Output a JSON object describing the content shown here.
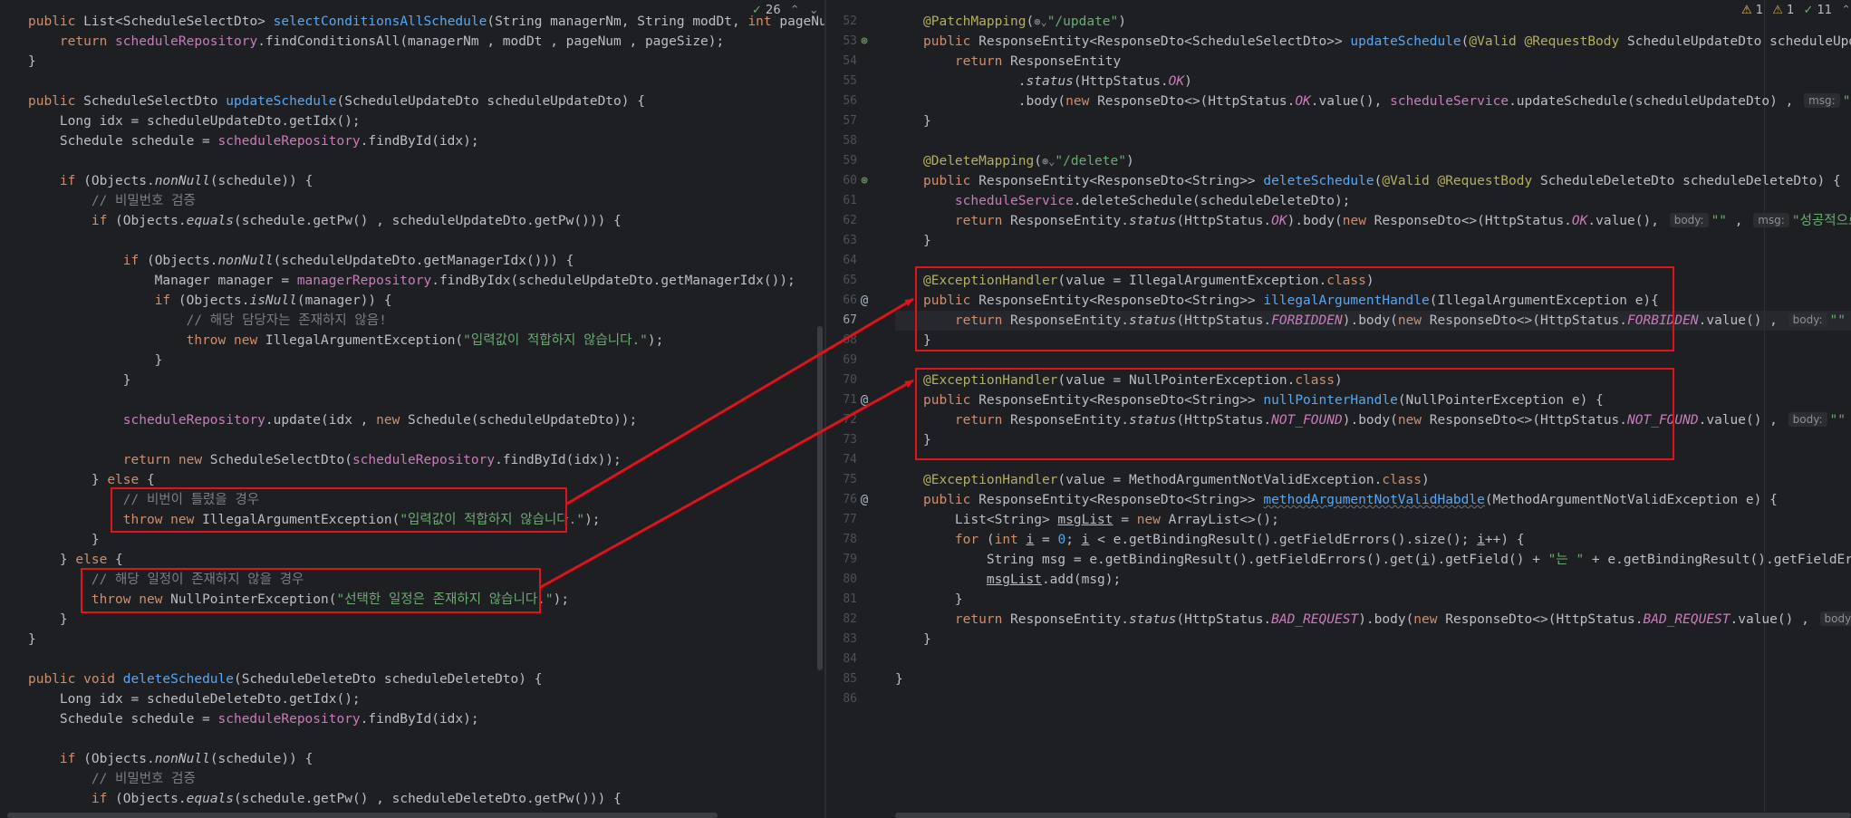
{
  "left_pane": {
    "inspection": {
      "check_count": "26",
      "up": "⌃",
      "down": "⌄"
    }
  },
  "right_pane": {
    "inspection": {
      "warning_count": "1",
      "weak_warning_count": "1",
      "check_count": "11",
      "up": "⌃",
      "down": "⌄"
    },
    "line_numbers": [
      "52",
      "53",
      "54",
      "55",
      "56",
      "57",
      "58",
      "59",
      "60",
      "61",
      "62",
      "63",
      "64",
      "65",
      "66",
      "67",
      "68",
      "69",
      "70",
      "71",
      "72",
      "73",
      "74",
      "75",
      "76",
      "77",
      "78",
      "79",
      "80",
      "81",
      "82",
      "83",
      "84",
      "85",
      "86"
    ]
  },
  "hints": {
    "msg": "msg:",
    "body": "body:"
  },
  "strings": {
    "invalid_input": "\"입력값이 적합하지 않습니다.\"",
    "schedule_not_found": "\"선택한 일정은 존재하지 않습니다.\"",
    "update_success": "\"성공적으로 수",
    "delete_success": "\"성공적으로 삭제완료했",
    "empty": "\"\"",
    "neun": "\"는 \"",
    "update_path": "\"/update\"",
    "delete_path": "\"/delete\""
  },
  "comments": {
    "verify_pw": "// 비밀번호 검증",
    "manager_not_exist": "// 해당 담당자는 존재하지 않음!",
    "pw_wrong": "// 비번이 틀렸을 경우",
    "schedule_not_exist": "// 해당 일정이 존재하지 않을 경우"
  },
  "colors": {
    "highlight_box": "#e0121b",
    "arrow": "#e0121b",
    "background": "#1e1f22"
  }
}
